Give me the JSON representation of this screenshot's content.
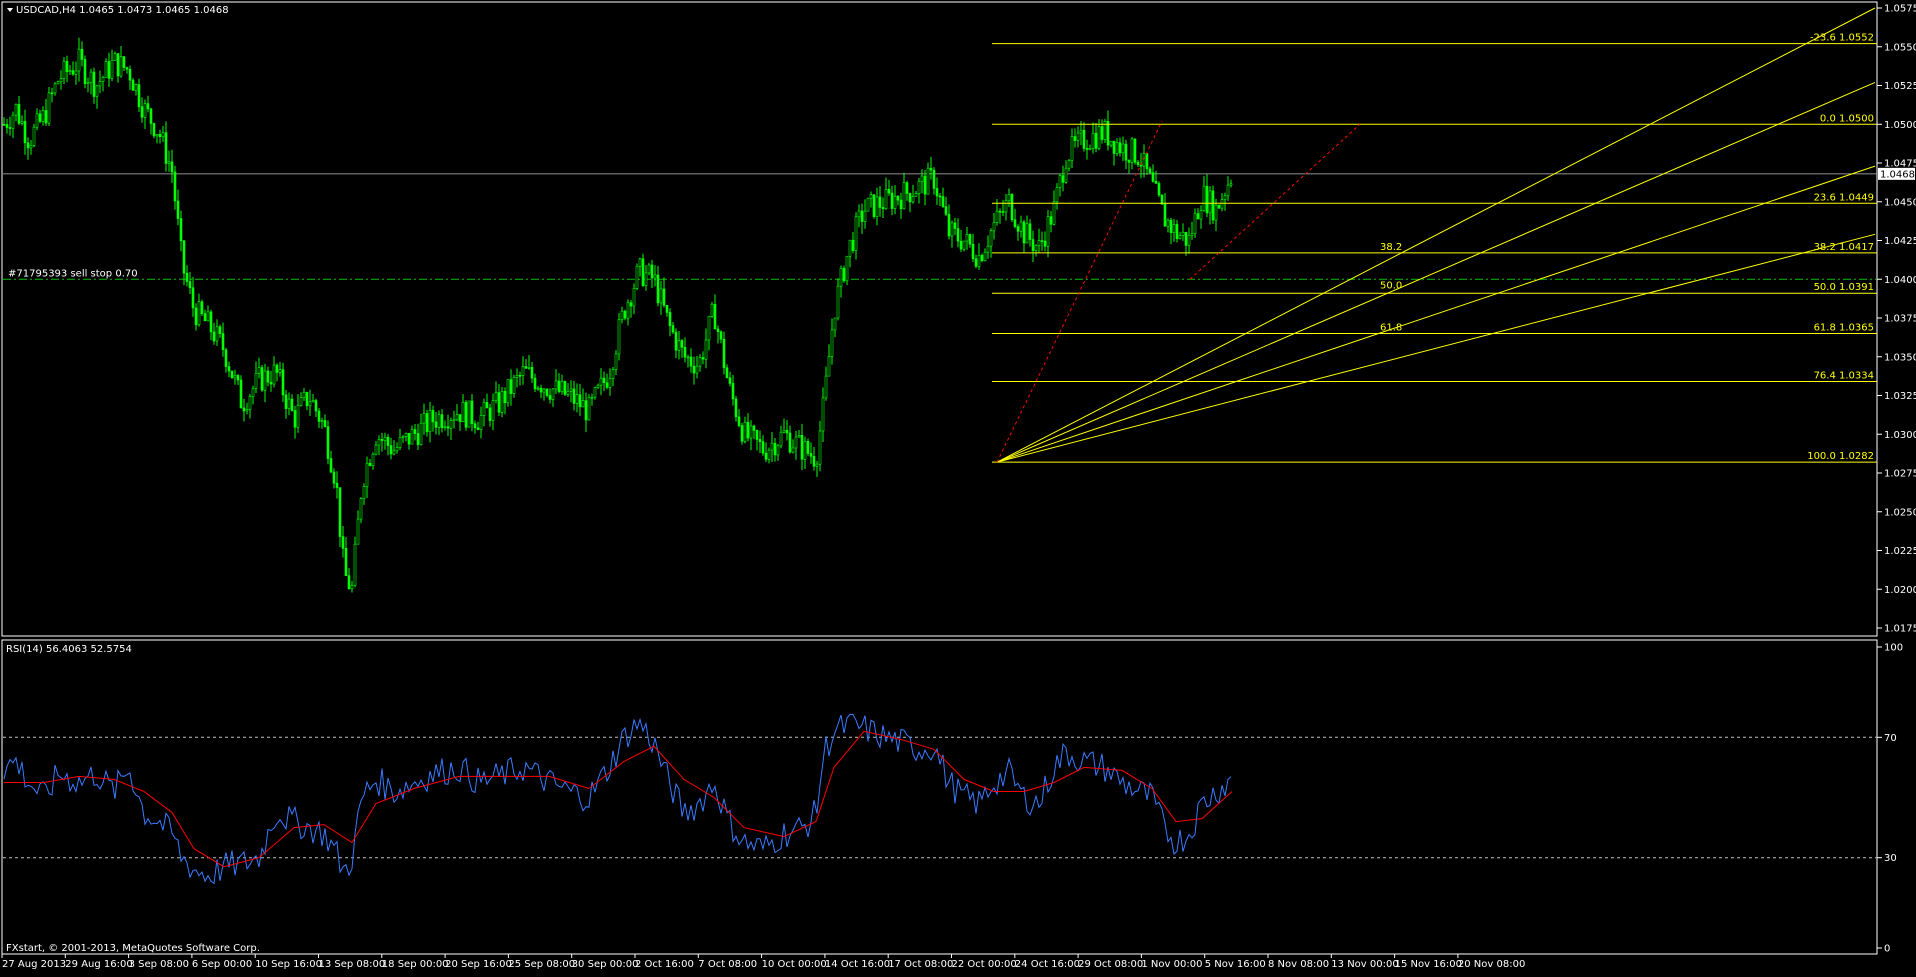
{
  "header": {
    "symbol_title": "USDCAD,H4  1.0465 1.0473 1.0465 1.0468",
    "indicator_title": "RSI(14) 56.4063 52.5754",
    "copyright": "FXstart, © 2001-2013, MetaQuotes Software Corp.",
    "order_label": "#71795393 sell stop 0.70",
    "current_price": "1.0468"
  },
  "colors": {
    "background": "#000000",
    "candle": "#00ff00",
    "fib": "#ffff00",
    "fib_trend": "#ff0000",
    "order_line": "#00c000",
    "rsi_main": "#3a7bff",
    "rsi_signal": "#ff0000",
    "axis": "#ffffff"
  },
  "chart_data": [
    {
      "type": "candlestick",
      "symbol": "USDCAD",
      "timeframe": "H4",
      "ylim": [
        1.0175,
        1.0575
      ],
      "y_ticks": [
        "1.0575",
        "1.0550",
        "1.0525",
        "1.0500",
        "1.0475",
        "1.0450",
        "1.0425",
        "1.0400",
        "1.0375",
        "1.0350",
        "1.0325",
        "1.0300",
        "1.0275",
        "1.0250",
        "1.0225",
        "1.0200",
        "1.0175"
      ],
      "x_ticks": [
        "27 Aug 2013",
        "29 Aug 16:00",
        "3 Sep 08:00",
        "6 Sep 00:00",
        "10 Sep 16:00",
        "13 Sep 08:00",
        "18 Sep 00:00",
        "20 Sep 16:00",
        "25 Sep 08:00",
        "30 Sep 00:00",
        "2 Oct 16:00",
        "7 Oct 08:00",
        "10 Oct 00:00",
        "14 Oct 16:00",
        "17 Oct 08:00",
        "22 Oct 00:00",
        "24 Oct 16:00",
        "29 Oct 08:00",
        "1 Nov 00:00",
        "5 Nov 16:00",
        "8 Nov 08:00",
        "13 Nov 00:00",
        "15 Nov 16:00",
        "20 Nov 08:00"
      ],
      "close_path": [
        [
          0,
          1.05
        ],
        [
          12,
          1.051
        ],
        [
          25,
          1.049
        ],
        [
          40,
          1.0505
        ],
        [
          55,
          1.053
        ],
        [
          75,
          1.054
        ],
        [
          92,
          1.0525
        ],
        [
          110,
          1.054
        ],
        [
          125,
          1.0535
        ],
        [
          140,
          1.051
        ],
        [
          155,
          1.0495
        ],
        [
          168,
          1.047
        ],
        [
          178,
          1.041
        ],
        [
          190,
          1.038
        ],
        [
          205,
          1.037
        ],
        [
          220,
          1.0355
        ],
        [
          238,
          1.032
        ],
        [
          255,
          1.0335
        ],
        [
          272,
          1.034
        ],
        [
          290,
          1.031
        ],
        [
          305,
          1.0325
        ],
        [
          320,
          1.0305
        ],
        [
          332,
          1.027
        ],
        [
          340,
          1.021
        ],
        [
          348,
          1.02
        ],
        [
          358,
          1.027
        ],
        [
          372,
          1.03
        ],
        [
          390,
          1.029
        ],
        [
          410,
          1.03
        ],
        [
          430,
          1.031
        ],
        [
          455,
          1.0315
        ],
        [
          475,
          1.031
        ],
        [
          495,
          1.032
        ],
        [
          520,
          1.034
        ],
        [
          545,
          1.033
        ],
        [
          565,
          1.0325
        ],
        [
          585,
          1.0315
        ],
        [
          605,
          1.034
        ],
        [
          620,
          1.038
        ],
        [
          635,
          1.0405
        ],
        [
          650,
          1.04
        ],
        [
          665,
          1.037
        ],
        [
          680,
          1.035
        ],
        [
          695,
          1.0345
        ],
        [
          710,
          1.038
        ],
        [
          725,
          1.033
        ],
        [
          740,
          1.03
        ],
        [
          760,
          1.029
        ],
        [
          780,
          1.03
        ],
        [
          800,
          1.029
        ],
        [
          812,
          1.0285
        ],
        [
          820,
          1.032
        ],
        [
          830,
          1.038
        ],
        [
          845,
          1.042
        ],
        [
          860,
          1.0445
        ],
        [
          880,
          1.045
        ],
        [
          900,
          1.0455
        ],
        [
          915,
          1.046
        ],
        [
          930,
          1.0465
        ],
        [
          945,
          1.043
        ],
        [
          960,
          1.0425
        ],
        [
          975,
          1.0415
        ],
        [
          990,
          1.0435
        ],
        [
          1005,
          1.045
        ],
        [
          1020,
          1.043
        ],
        [
          1035,
          1.042
        ],
        [
          1050,
          1.0445
        ],
        [
          1062,
          1.048
        ],
        [
          1080,
          1.049
        ],
        [
          1100,
          1.0495
        ],
        [
          1118,
          1.0485
        ],
        [
          1135,
          1.048
        ],
        [
          1148,
          1.046
        ],
        [
          1160,
          1.044
        ],
        [
          1172,
          1.043
        ],
        [
          1185,
          1.0425
        ],
        [
          1198,
          1.0455
        ],
        [
          1212,
          1.0445
        ],
        [
          1228,
          1.0468
        ]
      ]
    },
    {
      "type": "line",
      "name": "RSI(14)",
      "ylim": [
        0,
        100
      ],
      "y_ticks": [
        "100",
        "70",
        "30",
        "0"
      ],
      "levels": [
        70,
        30
      ],
      "main_path": [
        [
          0,
          60
        ],
        [
          12,
          62
        ],
        [
          25,
          55
        ],
        [
          40,
          50
        ],
        [
          55,
          58
        ],
        [
          75,
          55
        ],
        [
          92,
          58
        ],
        [
          110,
          52
        ],
        [
          125,
          60
        ],
        [
          140,
          45
        ],
        [
          155,
          42
        ],
        [
          168,
          38
        ],
        [
          178,
          30
        ],
        [
          190,
          26
        ],
        [
          205,
          24
        ],
        [
          220,
          27
        ],
        [
          238,
          28
        ],
        [
          255,
          30
        ],
        [
          272,
          45
        ],
        [
          290,
          42
        ],
        [
          305,
          40
        ],
        [
          320,
          38
        ],
        [
          332,
          32
        ],
        [
          340,
          25
        ],
        [
          348,
          30
        ],
        [
          358,
          50
        ],
        [
          372,
          56
        ],
        [
          390,
          52
        ],
        [
          410,
          55
        ],
        [
          430,
          58
        ],
        [
          455,
          60
        ],
        [
          475,
          55
        ],
        [
          495,
          57
        ],
        [
          520,
          60
        ],
        [
          545,
          55
        ],
        [
          565,
          52
        ],
        [
          585,
          50
        ],
        [
          605,
          60
        ],
        [
          620,
          70
        ],
        [
          635,
          75
        ],
        [
          650,
          68
        ],
        [
          665,
          55
        ],
        [
          680,
          45
        ],
        [
          695,
          48
        ],
        [
          710,
          55
        ],
        [
          725,
          42
        ],
        [
          740,
          35
        ],
        [
          760,
          33
        ],
        [
          780,
          38
        ],
        [
          800,
          40
        ],
        [
          812,
          45
        ],
        [
          820,
          65
        ],
        [
          830,
          72
        ],
        [
          845,
          74
        ],
        [
          860,
          73
        ],
        [
          880,
          70
        ],
        [
          900,
          68
        ],
        [
          915,
          66
        ],
        [
          930,
          67
        ],
        [
          945,
          55
        ],
        [
          960,
          50
        ],
        [
          975,
          48
        ],
        [
          990,
          55
        ],
        [
          1005,
          58
        ],
        [
          1020,
          50
        ],
        [
          1035,
          48
        ],
        [
          1050,
          60
        ],
        [
          1062,
          65
        ],
        [
          1080,
          62
        ],
        [
          1100,
          60
        ],
        [
          1118,
          55
        ],
        [
          1135,
          52
        ],
        [
          1148,
          50
        ],
        [
          1160,
          40
        ],
        [
          1172,
          35
        ],
        [
          1185,
          38
        ],
        [
          1198,
          48
        ],
        [
          1212,
          52
        ],
        [
          1228,
          56
        ]
      ],
      "signal_path": [
        [
          0,
          55
        ],
        [
          40,
          55
        ],
        [
          75,
          57
        ],
        [
          110,
          56
        ],
        [
          140,
          52
        ],
        [
          168,
          45
        ],
        [
          190,
          33
        ],
        [
          220,
          27
        ],
        [
          255,
          30
        ],
        [
          290,
          40
        ],
        [
          320,
          41
        ],
        [
          348,
          35
        ],
        [
          372,
          48
        ],
        [
          410,
          53
        ],
        [
          455,
          57
        ],
        [
          495,
          57
        ],
        [
          545,
          57
        ],
        [
          585,
          53
        ],
        [
          620,
          62
        ],
        [
          650,
          67
        ],
        [
          680,
          56
        ],
        [
          710,
          50
        ],
        [
          740,
          40
        ],
        [
          780,
          37
        ],
        [
          812,
          42
        ],
        [
          830,
          60
        ],
        [
          860,
          72
        ],
        [
          900,
          69
        ],
        [
          930,
          66
        ],
        [
          960,
          56
        ],
        [
          990,
          52
        ],
        [
          1020,
          52
        ],
        [
          1050,
          55
        ],
        [
          1080,
          60
        ],
        [
          1118,
          59
        ],
        [
          1148,
          53
        ],
        [
          1172,
          42
        ],
        [
          1198,
          43
        ],
        [
          1228,
          52
        ]
      ]
    }
  ],
  "fibonacci": [
    {
      "level": "-23.6",
      "price": 1.0552,
      "label": "-23.6  1.0552"
    },
    {
      "level": "0.0",
      "price": 1.05,
      "label": "0.0  1.0500"
    },
    {
      "level": "23.6",
      "price": 1.0449,
      "label": "23.6  1.0449"
    },
    {
      "level": "38.2",
      "price": 1.0417,
      "label": "38.2  1.0417"
    },
    {
      "level": "50.0",
      "price": 1.0391,
      "label": "50.0  1.0391"
    },
    {
      "level": "61.8",
      "price": 1.0365,
      "label": "61.8  1.0365"
    },
    {
      "level": "76.4",
      "price": 1.0334,
      "label": "76.4  1.0334"
    },
    {
      "level": "100.0",
      "price": 1.0282,
      "label": "100.0  1.0282"
    }
  ],
  "fib_fan_labels": [
    {
      "text": "38.2",
      "price": 1.0419
    },
    {
      "text": "50.0",
      "price": 1.0394
    },
    {
      "text": "61.8",
      "price": 1.0367
    }
  ],
  "order_level": 1.04
}
